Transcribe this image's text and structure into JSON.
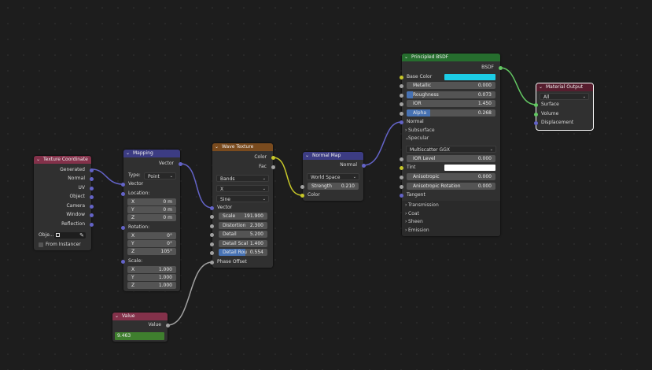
{
  "nodes": {
    "texcoord": {
      "title": "Texture Coordinate",
      "outputs": [
        "Generated",
        "Normal",
        "UV",
        "Object",
        "Camera",
        "Window",
        "Reflection"
      ],
      "object_label": "Obje...",
      "from_instancer": "From Instancer"
    },
    "mapping": {
      "title": "Mapping",
      "output": "Vector",
      "type_label": "Type:",
      "type_value": "Point",
      "vector_input": "Vector",
      "location_label": "Location:",
      "location": [
        {
          "axis": "X",
          "value": "0 m"
        },
        {
          "axis": "Y",
          "value": "0 m"
        },
        {
          "axis": "Z",
          "value": "0 m"
        }
      ],
      "rotation_label": "Rotation:",
      "rotation": [
        {
          "axis": "X",
          "value": "0°"
        },
        {
          "axis": "Y",
          "value": "0°"
        },
        {
          "axis": "Z",
          "value": "105°"
        }
      ],
      "scale_label": "Scale:",
      "scale": [
        {
          "axis": "X",
          "value": "1.000"
        },
        {
          "axis": "Y",
          "value": "1.000"
        },
        {
          "axis": "Z",
          "value": "1.000"
        }
      ]
    },
    "wave": {
      "title": "Wave Texture",
      "out_color": "Color",
      "out_fac": "Fac",
      "type": "Bands",
      "direction": "X",
      "profile": "Sine",
      "vector_input": "Vector",
      "params": [
        {
          "label": "Scale",
          "value": "191.900"
        },
        {
          "label": "Distortion",
          "value": "2.300"
        },
        {
          "label": "Detail",
          "value": "5.200"
        },
        {
          "label": "Detail Scal",
          "value": "1.400"
        },
        {
          "label": "Detail Rou",
          "value": "0.554",
          "fill": 0.55
        }
      ],
      "phase": "Phase Offset"
    },
    "normalmap": {
      "title": "Normal Map",
      "output": "Normal",
      "space": "World Space",
      "strength_label": "Strength",
      "strength_value": "0.210",
      "color_input": "Color"
    },
    "value": {
      "title": "Value",
      "output": "Value",
      "value": "9.463"
    },
    "bsdf": {
      "title": "Principled BSDF",
      "output": "BSDF",
      "base_color_label": "Base Color",
      "base_color": "#1ccde6",
      "params": [
        {
          "label": "Metallic",
          "value": "0.000"
        },
        {
          "label": "Roughness",
          "value": "0.073",
          "fill": 0.073
        },
        {
          "label": "IOR",
          "value": "1.450"
        },
        {
          "label": "Alpha",
          "value": "0.268",
          "fill": 0.268
        }
      ],
      "normal": "Normal",
      "subsurface": "Subsurface",
      "specular": "Specular",
      "distribution": "Multiscatter GGX",
      "ior_level_label": "IOR Level",
      "ior_level_value": "0.000",
      "tint_label": "Tint",
      "tint_color": "#ffffff",
      "anisotropic_label": "Anisotropic",
      "anisotropic_value": "0.000",
      "aniso_rot_label": "Anisotropic Rotation",
      "aniso_rot_value": "0.000",
      "tangent": "Tangent",
      "panels": [
        "Transmission",
        "Coat",
        "Sheen",
        "Emission"
      ]
    },
    "output": {
      "title": "Material Output",
      "target": "All",
      "inputs": [
        "Surface",
        "Volume",
        "Displacement"
      ]
    }
  },
  "colors": {
    "vector_socket": "#6363c7",
    "color_socket": "#c7c729",
    "float_socket": "#a1a1a1",
    "shader_socket": "#63c763",
    "header_input": "#83314a",
    "header_vector": "#3c3c83",
    "header_texture": "#7a4b1e",
    "header_shader": "#266e2e",
    "header_output": "#571d2e",
    "field_fill": "#4772b3"
  }
}
